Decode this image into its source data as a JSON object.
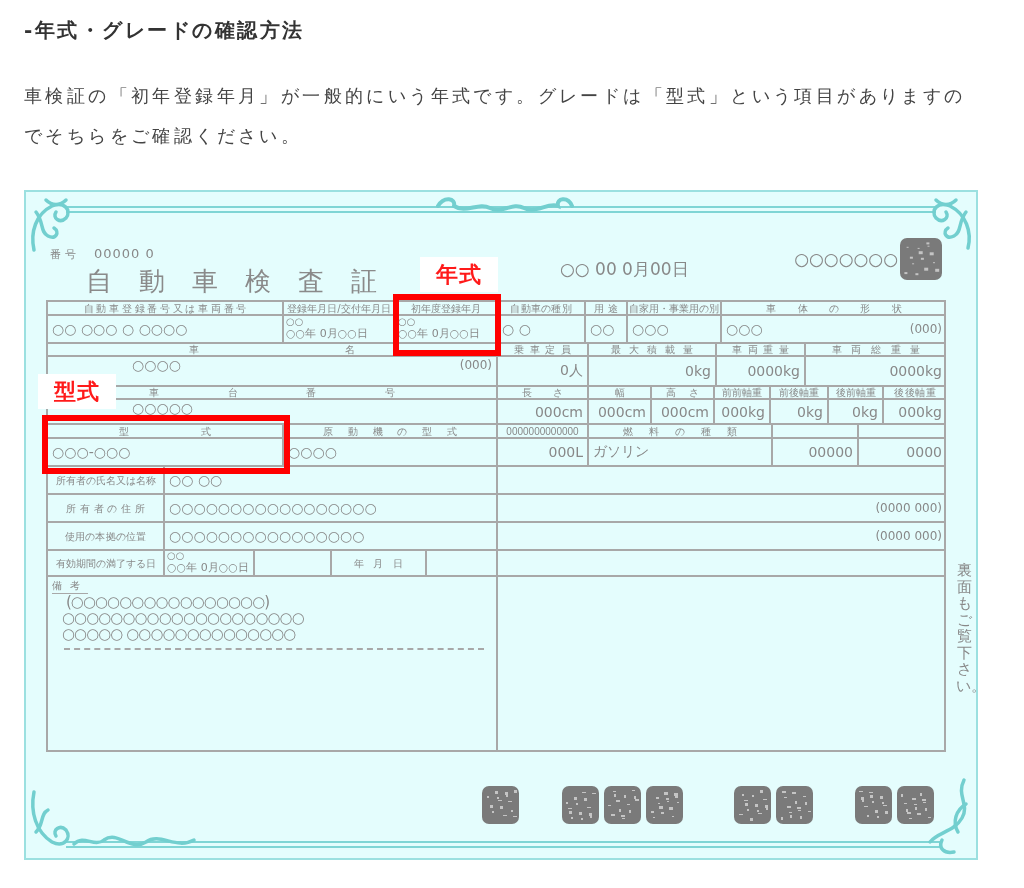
{
  "heading": "-年式・グレードの確認方法",
  "paragraph": "車検証の「初年登録年月」が一般的にいう年式です。グレードは「型式」という項目がありますのでそちらをご確認ください。",
  "certificate": {
    "number_label": "番号",
    "number": "00000 0",
    "title": "自動車検査証",
    "issue_date": "○○ 00 0月00日",
    "serial": "○○○○○○○",
    "left_rows": [
      {
        "cells": [
          {
            "kind": "label",
            "text": "自動車登録番号又は車両番号"
          },
          {
            "kind": "label",
            "text": "登録年月日/交付年月日"
          },
          {
            "kind": "label",
            "text": "初年度登録年月"
          }
        ]
      },
      {
        "cells": [
          {
            "kind": "value",
            "text": "○○ ○○○ ○ ○○○○"
          },
          {
            "kind": "value",
            "era": "○○",
            "text": "○○年 0月○○日"
          },
          {
            "kind": "value",
            "era": "○○",
            "text": "○○年 0月○○日"
          }
        ]
      },
      {
        "cells": [
          {
            "kind": "label",
            "text": "車名"
          }
        ]
      },
      {
        "cells": [
          {
            "kind": "value",
            "text": "○○○○",
            "note": "(000)"
          }
        ]
      },
      {
        "cells": [
          {
            "kind": "label",
            "text": "車台番号"
          }
        ]
      },
      {
        "cells": [
          {
            "kind": "value",
            "text": "○○○○○"
          }
        ]
      },
      {
        "cells": [
          {
            "kind": "label",
            "text": "型式"
          },
          {
            "kind": "label",
            "text": "原動機の型式"
          }
        ]
      },
      {
        "cells": [
          {
            "kind": "value",
            "text": "○○○-○○○"
          },
          {
            "kind": "value",
            "text": "○○○○"
          }
        ]
      },
      {
        "cells": [
          {
            "kind": "label",
            "text": "所有者の氏名又は名称"
          },
          {
            "kind": "value",
            "text": "○○ ○○"
          }
        ]
      },
      {
        "cells": [
          {
            "kind": "label",
            "text": "所有者の住所"
          },
          {
            "kind": "value",
            "text": "○○○○○○○○○○○○○○○○○"
          }
        ]
      },
      {
        "cells": [
          {
            "kind": "label",
            "text": "使用の本拠の位置"
          },
          {
            "kind": "value",
            "text": "○○○○○○○○○○○○○○○○"
          }
        ]
      },
      {
        "cells": [
          {
            "kind": "label",
            "text": "有効期間の満了する日"
          },
          {
            "kind": "value",
            "era": "○○",
            "text": "○○年 0月○○日"
          },
          {
            "kind": "blank"
          },
          {
            "kind": "label",
            "text": "年 月 日"
          },
          {
            "kind": "blank"
          }
        ]
      },
      {
        "cells": [
          {
            "kind": "remarks",
            "label": "備考",
            "lines": [
              "(○○○○○○○○○○○○○○○○)",
              "○○○○○○○○○○○○○○○○○○○○",
              "○○○○○ ○○○○○○○○○○○○○○"
            ]
          }
        ]
      }
    ],
    "right_rows": [
      {
        "cells": [
          {
            "kind": "label",
            "text": "自動車の種別"
          },
          {
            "kind": "label",
            "text": "用途"
          },
          {
            "kind": "label",
            "text": "自家用・事業用の別"
          },
          {
            "kind": "label",
            "text": "車体の形状"
          }
        ]
      },
      {
        "cells": [
          {
            "kind": "value",
            "text": "○ ○"
          },
          {
            "kind": "value",
            "text": "○○"
          },
          {
            "kind": "value",
            "text": "○○○"
          },
          {
            "kind": "value",
            "text": "○○○",
            "note": "(000)"
          }
        ]
      },
      {
        "cells": [
          {
            "kind": "label",
            "text": "乗車定員"
          },
          {
            "kind": "label",
            "text": "最大積載量"
          },
          {
            "kind": "label",
            "text": "車両重量"
          },
          {
            "kind": "label",
            "text": "車両総重量"
          }
        ]
      },
      {
        "cells": [
          {
            "kind": "number",
            "text": "0人"
          },
          {
            "kind": "number",
            "text": "0kg"
          },
          {
            "kind": "number",
            "text": "0000kg"
          },
          {
            "kind": "number",
            "text": "0000kg"
          }
        ]
      },
      {
        "cells": [
          {
            "kind": "label",
            "text": "長さ"
          },
          {
            "kind": "label",
            "text": "幅"
          },
          {
            "kind": "label",
            "text": "高さ"
          },
          {
            "kind": "label",
            "text": "前前軸重"
          },
          {
            "kind": "label",
            "text": "前後軸重"
          },
          {
            "kind": "label",
            "text": "後前軸重"
          },
          {
            "kind": "label",
            "text": "後後軸重"
          }
        ]
      },
      {
        "cells": [
          {
            "kind": "number",
            "text": "000cm"
          },
          {
            "kind": "number",
            "text": "000cm"
          },
          {
            "kind": "number",
            "text": "000cm"
          },
          {
            "kind": "number",
            "text": "000kg"
          },
          {
            "kind": "number",
            "text": "0kg"
          },
          {
            "kind": "number",
            "text": "0kg"
          },
          {
            "kind": "number",
            "text": "000kg"
          }
        ]
      },
      {
        "cells": [
          {
            "kind": "small",
            "text": "0000000000000"
          },
          {
            "kind": "label",
            "text": "燃料の種類"
          },
          {
            "kind": "blank"
          },
          {
            "kind": "blank"
          }
        ]
      },
      {
        "cells": [
          {
            "kind": "number",
            "text": "000L"
          },
          {
            "kind": "value",
            "text": "ガソリン"
          },
          {
            "kind": "number",
            "text": "00000"
          },
          {
            "kind": "number",
            "text": "0000"
          }
        ]
      },
      {
        "cells": [
          {
            "kind": "blank"
          }
        ]
      },
      {
        "cells": [
          {
            "kind": "value",
            "note": "(0000 000)"
          }
        ]
      },
      {
        "cells": [
          {
            "kind": "value",
            "note": "(0000 000)"
          }
        ]
      },
      {
        "cells": [
          {
            "kind": "blank"
          }
        ]
      },
      {
        "cells": [
          {
            "kind": "blank"
          }
        ]
      }
    ],
    "side_note": "裏面もご覧下さい。",
    "highlights": [
      {
        "label": "年式"
      },
      {
        "label": "型式"
      }
    ]
  }
}
